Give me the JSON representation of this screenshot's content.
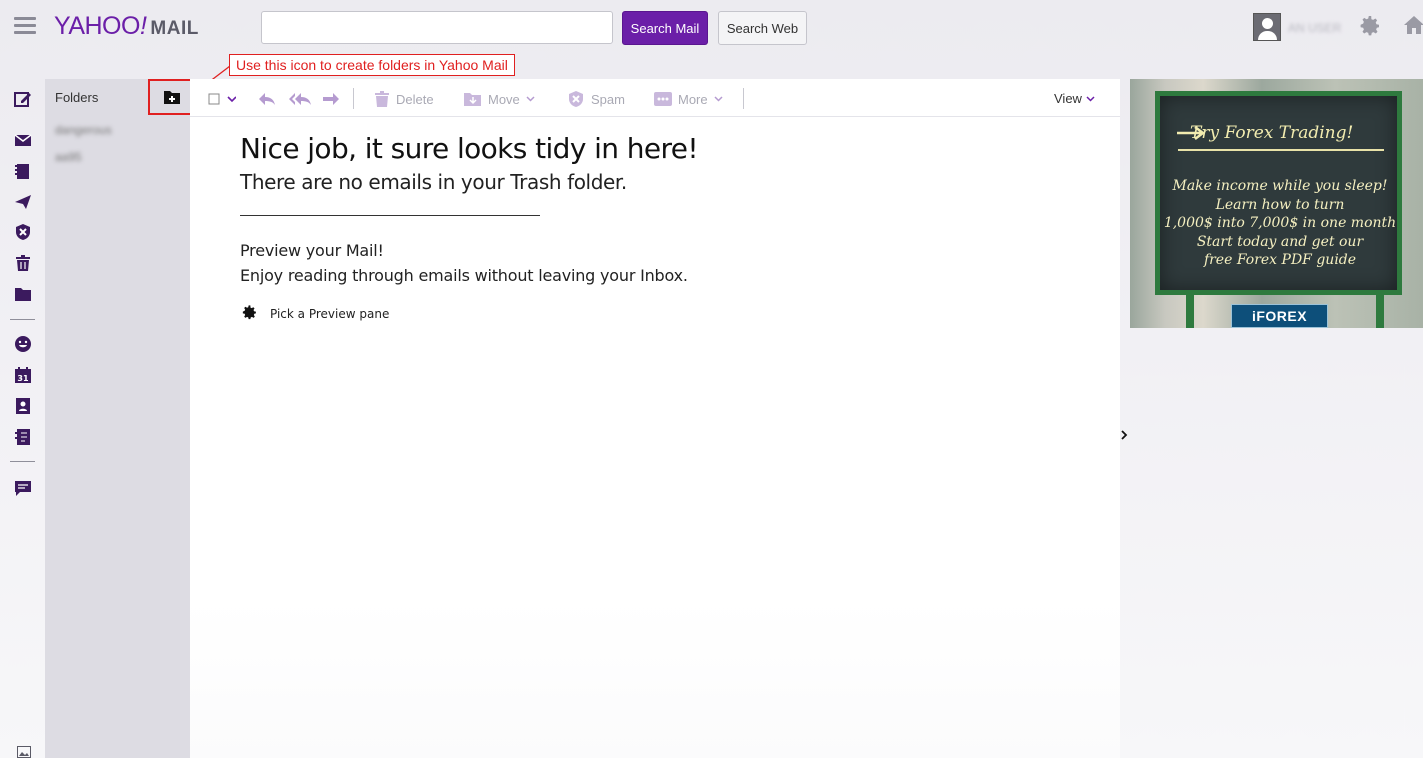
{
  "header": {
    "logo_main": "YAHOO",
    "logo_bang": "!",
    "logo_suffix": "MAIL",
    "search_value": "",
    "search_mail_label": "Search Mail",
    "search_web_label": "Search Web",
    "username": "AN USER"
  },
  "rail": {
    "icons": [
      "compose-icon",
      "inbox-icon",
      "drafts-icon",
      "sent-icon",
      "spam-icon",
      "trash-icon",
      "folder-icon",
      "emoji-icon",
      "calendar-icon",
      "contacts-icon",
      "notepad-icon",
      "messenger-icon"
    ]
  },
  "folders": {
    "title": "Folders",
    "items": [
      "dangerous",
      "aa95"
    ]
  },
  "callout": {
    "text": "Use this icon to create folders in Yahoo Mail",
    "color": "#e02020"
  },
  "toolbar": {
    "delete_label": "Delete",
    "move_label": "Move",
    "spam_label": "Spam",
    "more_label": "More",
    "view_label": "View"
  },
  "content": {
    "title": "Nice job, it sure looks tidy in here!",
    "subtitle": "There are no emails in your Trash folder.",
    "preview_heading": "Preview your Mail!",
    "preview_text": "Enjoy reading through emails without leaving your Inbox.",
    "pick_pane_label": "Pick a Preview pane"
  },
  "ad": {
    "headline": "Try Forex Trading!",
    "lines": [
      "Make income while you sleep!",
      "Learn how to turn",
      "1,000$ into 7,000$ in one month",
      "Start today and get our",
      "free Forex PDF guide"
    ],
    "brand": "iFOREX"
  },
  "colors": {
    "accent": "#6b1fa8",
    "annotation": "#e02020",
    "toolbar_icon": "#b59bd0"
  }
}
